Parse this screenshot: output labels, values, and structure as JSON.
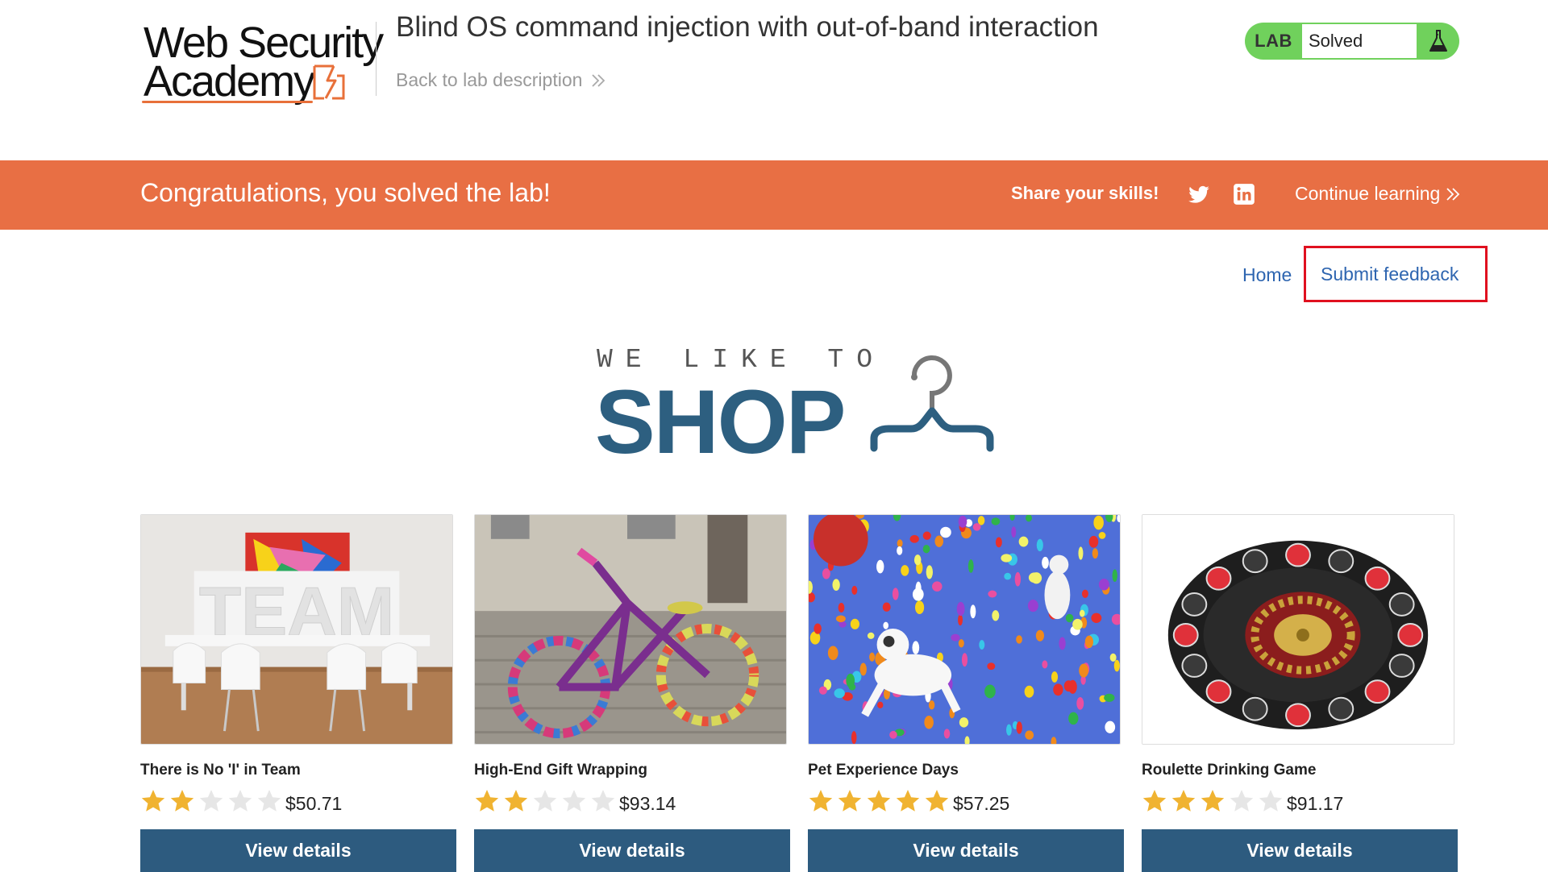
{
  "header": {
    "logo": {
      "line1": "Web Security",
      "line2": "Academy"
    },
    "lab_title": "Blind OS command injection with out-of-band interaction",
    "back_link": "Back to lab description",
    "lab_badge": {
      "label": "LAB",
      "status": "Solved",
      "icon": "flask-icon"
    }
  },
  "banner": {
    "message": "Congratulations, you solved the lab!",
    "share_label": "Share your skills!",
    "share_icons": [
      "twitter-icon",
      "linkedin-icon"
    ],
    "continue_link": "Continue learning"
  },
  "nav": {
    "home": "Home",
    "submit_feedback": "Submit feedback"
  },
  "hero": {
    "tagline": "WE LIKE TO",
    "headline": "SHOP",
    "icon": "hanger-icon"
  },
  "products": [
    {
      "name": "There is No 'I' in Team",
      "rating": 2,
      "price": "$50.71",
      "button": "View details",
      "image": "team-room-photo"
    },
    {
      "name": "High-End Gift Wrapping",
      "rating": 2,
      "price": "$93.14",
      "button": "View details",
      "image": "knitted-bicycle-photo"
    },
    {
      "name": "Pet Experience Days",
      "rating": 5,
      "price": "$57.25",
      "button": "View details",
      "image": "dog-balloons-photo"
    },
    {
      "name": "Roulette Drinking Game",
      "rating": 3,
      "price": "$91.17",
      "button": "View details",
      "image": "roulette-shots-photo"
    }
  ],
  "colors": {
    "accent_orange": "#e86f44",
    "solved_green": "#70d15c",
    "button_blue": "#2d5b7f",
    "link_blue": "#2e65b0",
    "star_gold": "#f0b331",
    "star_empty": "#e6e6e6",
    "highlight_red": "#e0101f"
  }
}
